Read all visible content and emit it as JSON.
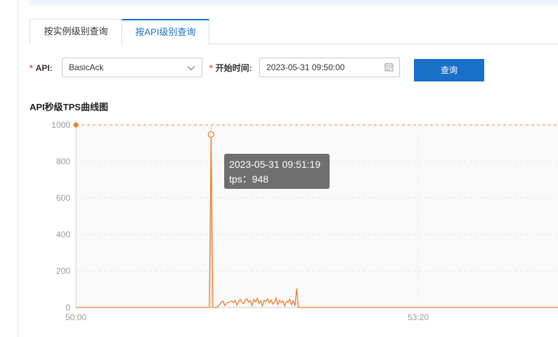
{
  "tabs": [
    {
      "label": "按实例级别查询",
      "active": false
    },
    {
      "label": "按API级别查询",
      "active": true
    }
  ],
  "form": {
    "required_mark": "*",
    "api_label": "API:",
    "api_value": "BasicAck",
    "start_time_label": "开始时间:",
    "start_time_value": "2023-05-31 09:50:00",
    "query_button": "查询"
  },
  "chart_title": "API秒级TPS曲线图",
  "tooltip": {
    "time": "2023-05-31 09:51:19",
    "tps_line": "tps：948"
  },
  "colors": {
    "accent": "#1a6fc9",
    "series": "#f07c2c",
    "required": "#e6502a"
  },
  "chart_data": {
    "type": "line",
    "title": "API秒级TPS曲线图",
    "xlabel": "",
    "ylabel": "",
    "ylim": [
      0,
      1000
    ],
    "yticks": [
      0,
      200,
      400,
      600,
      800,
      1000
    ],
    "xlim": [
      0,
      300
    ],
    "xticks": [
      {
        "value": 0,
        "label": "50:00"
      },
      {
        "value": 200,
        "label": "53:20"
      }
    ],
    "markline": {
      "y": 1000
    },
    "highlight": {
      "x": 79,
      "y": 948
    },
    "series": [
      {
        "x": [
          0,
          77,
          78,
          79,
          80,
          81,
          82,
          84,
          85,
          86,
          87,
          88,
          89,
          90,
          91,
          92,
          93,
          94,
          95,
          96,
          97,
          98,
          99,
          100,
          101,
          102,
          103,
          104,
          105,
          106,
          107,
          108,
          109,
          110,
          111,
          112,
          113,
          114,
          115,
          116,
          117,
          118,
          119,
          120,
          121,
          122,
          123,
          124,
          125,
          126,
          127,
          128,
          129,
          130,
          131,
          132,
          133,
          300
        ],
        "values": [
          0,
          0,
          0,
          948,
          0,
          0,
          0,
          15,
          30,
          36,
          10,
          22,
          28,
          32,
          35,
          26,
          40,
          12,
          30,
          46,
          28,
          20,
          42,
          48,
          28,
          38,
          10,
          45,
          30,
          52,
          22,
          38,
          8,
          40,
          32,
          48,
          25,
          42,
          18,
          30,
          52,
          15,
          40,
          26,
          36,
          8,
          34,
          28,
          46,
          14,
          38,
          10,
          102,
          0,
          0,
          0,
          0,
          0
        ]
      }
    ]
  }
}
